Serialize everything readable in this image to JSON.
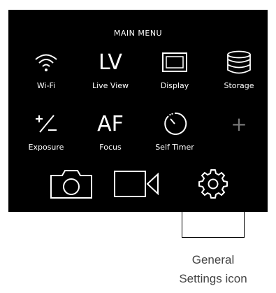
{
  "menu": {
    "title": "MAIN MENU",
    "row1": [
      {
        "label": "Wi-Fi",
        "icon": "wifi-icon"
      },
      {
        "label": "Live View",
        "icon": "lv-icon",
        "glyph": "LV"
      },
      {
        "label": "Display",
        "icon": "display-icon"
      },
      {
        "label": "Storage",
        "icon": "storage-icon"
      }
    ],
    "row2": [
      {
        "label": "Exposure",
        "icon": "exposure-icon"
      },
      {
        "label": "Focus",
        "icon": "af-icon",
        "glyph": "AF"
      },
      {
        "label": "Self Timer",
        "icon": "self-timer-icon"
      },
      {
        "label": "",
        "icon": "plus-icon",
        "glyph": "+"
      }
    ]
  },
  "bottom_bar": [
    {
      "icon": "camera-icon"
    },
    {
      "icon": "video-camera-icon"
    },
    {
      "icon": "settings-gear-icon"
    }
  ],
  "callout": {
    "line1": "General",
    "line2": "Settings icon"
  },
  "colors": {
    "screen_background": "#000000",
    "foreground": "#ffffff",
    "plus_dim": "#777777",
    "callout_text": "#444444"
  }
}
